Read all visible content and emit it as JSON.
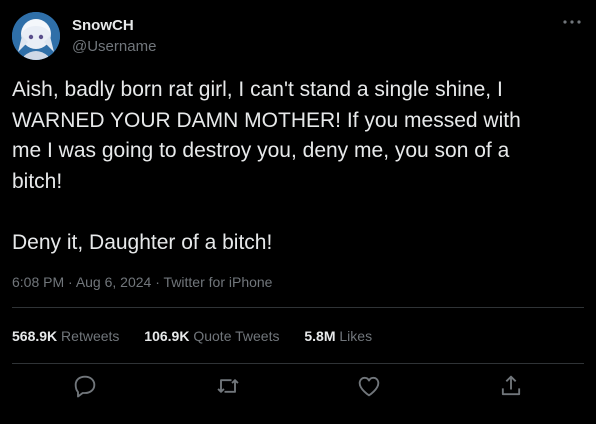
{
  "author": {
    "display_name": "SnowCH",
    "handle": "@Username"
  },
  "tweet": {
    "text": "Aish, badly born rat girl, I can't stand a single shine, I\nWARNED YOUR DAMN MOTHER! If you messed with\nme I was going to destroy you, deny me, you son of a\nbitch!\n\nDeny it, Daughter of a bitch!",
    "time": "6:08 PM",
    "date": "Aug 6, 2024",
    "source": "Twitter for iPhone"
  },
  "stats": {
    "retweets_count": "568.9K",
    "retweets_label": "Retweets",
    "quotes_count": "106.9K",
    "quotes_label": "Quote Tweets",
    "likes_count": "5.8M",
    "likes_label": "Likes"
  },
  "icons": {
    "more": "more-icon",
    "reply": "reply-icon",
    "retweet": "retweet-icon",
    "like": "like-icon",
    "share": "share-icon"
  },
  "colors": {
    "background": "#000000",
    "text": "#e7e9ea",
    "muted": "#71767b",
    "divider": "#2f3336"
  }
}
